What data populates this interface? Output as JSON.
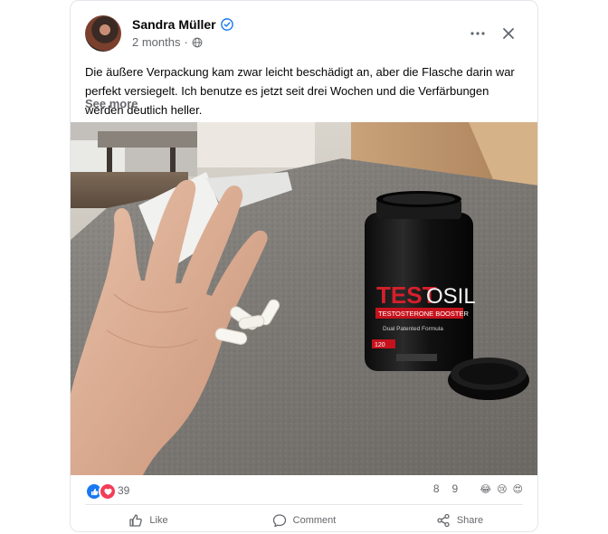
{
  "post": {
    "author": "Sandra Müller",
    "time": "2 months",
    "separator": "·",
    "text": "Die äußere Verpackung kam zwar leicht beschädigt an, aber die Flasche darin war perfekt versiegelt. Ich benutze es jetzt seit drei Wochen und die Verfärbungen werden deutlich heller.",
    "see_more": "See more"
  },
  "photo": {
    "bottle_brand_red": "TEST",
    "bottle_brand_white": "OSIL",
    "bottle_sub": "TESTOSTERONE BOOSTER",
    "bottle_formula": "Dual Patented Formula",
    "bottle_count": "120"
  },
  "reactions": {
    "total": "39",
    "comments": "8",
    "shares": "9",
    "icons": [
      "like-icon",
      "love-icon"
    ],
    "emojis": [
      "😂",
      "😢",
      "😍"
    ]
  },
  "actions": {
    "like": "Like",
    "comment": "Comment",
    "share": "Share"
  },
  "colors": {
    "verified": "#1877f2",
    "secondary_text": "#65676b",
    "like_blue": "#1877f2",
    "love_red": "#f33e58"
  }
}
